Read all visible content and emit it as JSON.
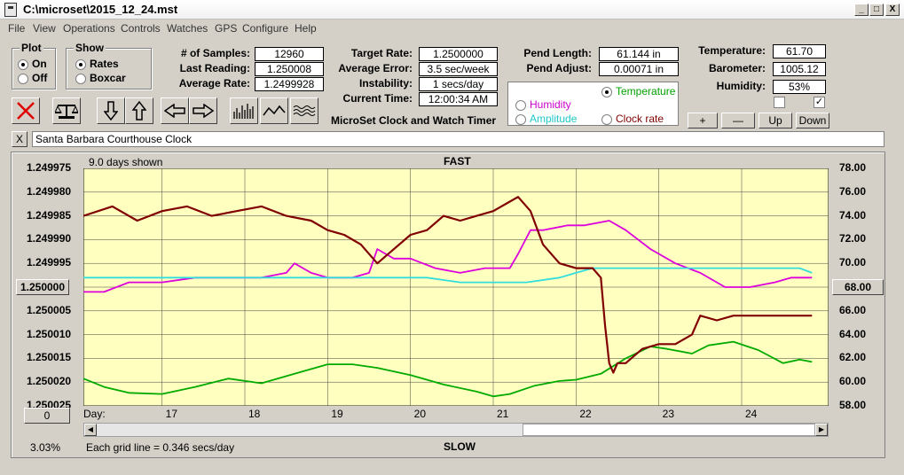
{
  "window": {
    "title": "C:\\microset\\2015_12_24.mst",
    "min_label": "_",
    "max_label": "□",
    "close_label": "X"
  },
  "menu": [
    "File",
    "View",
    "Operations",
    "Controls",
    "Watches",
    "GPS",
    "Configure",
    "Help"
  ],
  "plot_group": {
    "title": "Plot",
    "on_label": "On",
    "off_label": "Off",
    "selected": "On"
  },
  "show_group": {
    "title": "Show",
    "rates_label": "Rates",
    "boxcar_label": "Boxcar",
    "selected": "Rates"
  },
  "stats": {
    "samples_label": "# of Samples:",
    "samples": "12960",
    "last_reading_label": "Last Reading:",
    "last_reading": "1.250008",
    "average_rate_label": "Average Rate:",
    "average_rate": "1.2499928",
    "target_rate_label": "Target Rate:",
    "target_rate": "1.2500000",
    "average_error_label": "Average Error:",
    "average_error": "3.5 sec/week",
    "instability_label": "Instability:",
    "instability": "1 secs/day",
    "current_time_label": "Current Time:",
    "current_time": "12:00:34 AM",
    "pend_length_label": "Pend Length:",
    "pend_length": "61.144 in",
    "pend_adjust_label": "Pend Adjust:",
    "pend_adjust": "0.00071 in",
    "temperature_label": "Temperature:",
    "temperature": "61.70",
    "barometer_label": "Barometer:",
    "barometer": "1005.12",
    "humidity_label": "Humidity:",
    "humidity": "53%"
  },
  "app_caption": "MicroSet Clock and Watch Timer",
  "overlay": {
    "temperature": "Temperature",
    "humidity": "Humidity",
    "amplitude": "Amplitude",
    "clock_rate": "Clock rate",
    "selected": "Temperature"
  },
  "scale_buttons": {
    "plus": "+",
    "minus": "—",
    "up": "Up",
    "down": "Down"
  },
  "checkboxes": {
    "left": "",
    "right": "✓"
  },
  "clock_close": "X",
  "clock_name": "Santa Barbara Courthouse Clock",
  "graph": {
    "days_shown": "9.0 days shown",
    "top_label": "FAST",
    "bottom_label": "SLOW",
    "day_label": "Day:",
    "center_button": "1.250000",
    "right_center_button": "68.00",
    "zero_button": "0",
    "percent": "3.03%",
    "grid_note": "Each grid line = 0.346 secs/day"
  },
  "colors": {
    "plot_bg": "#ffffc0",
    "rate": "#800000",
    "temperature": "#00aa00",
    "humidity": "#dd00dd",
    "amplitude": "#33dddd"
  },
  "chart_data": {
    "type": "line",
    "title": "",
    "xlabel": "Day:",
    "x_ticks": [
      "17",
      "18",
      "19",
      "20",
      "21",
      "22",
      "23",
      "24"
    ],
    "x_tick_values": [
      17,
      18,
      19,
      20,
      21,
      22,
      23,
      24
    ],
    "xlim": [
      16.05,
      25.05
    ],
    "y_left_ticks": [
      "1.249975",
      "1.249980",
      "1.249985",
      "1.249990",
      "1.249995",
      "1.250000",
      "1.250005",
      "1.250010",
      "1.250015",
      "1.250020",
      "1.250025"
    ],
    "y_left_tick_values": [
      1.249975,
      1.24998,
      1.249985,
      1.24999,
      1.249995,
      1.25,
      1.250005,
      1.25001,
      1.250015,
      1.25002,
      1.250025
    ],
    "y_left_lim": [
      1.249975,
      1.250025
    ],
    "y_left_inverted": true,
    "y_right_ticks": [
      "78.00",
      "76.00",
      "74.00",
      "72.00",
      "70.00",
      "68.00",
      "66.00",
      "64.00",
      "62.00",
      "60.00",
      "58.00"
    ],
    "y_right_tick_values": [
      78,
      76,
      74,
      72,
      70,
      68,
      66,
      64,
      62,
      60,
      58
    ],
    "y_right_lim": [
      58,
      78
    ],
    "grid": true,
    "series": [
      {
        "key": "rate",
        "axis": "left",
        "x": [
          16.05,
          16.4,
          16.7,
          17.0,
          17.3,
          17.6,
          17.9,
          18.2,
          18.5,
          18.8,
          19.0,
          19.2,
          19.4,
          19.6,
          19.8,
          20.0,
          20.2,
          20.4,
          20.6,
          20.8,
          21.0,
          21.2,
          21.3,
          21.45,
          21.6,
          21.8,
          22.0,
          22.2,
          22.3,
          22.35,
          22.4,
          22.45,
          22.5,
          22.6,
          22.8,
          23.0,
          23.2,
          23.4,
          23.5,
          23.7,
          23.9,
          24.1,
          24.3,
          24.5,
          24.7,
          24.85
        ],
        "y": [
          1.249985,
          1.249983,
          1.249986,
          1.249984,
          1.249983,
          1.249985,
          1.249984,
          1.249983,
          1.249985,
          1.249986,
          1.249988,
          1.249989,
          1.249991,
          1.249995,
          1.249992,
          1.249989,
          1.249988,
          1.249985,
          1.249986,
          1.249985,
          1.249984,
          1.249982,
          1.249981,
          1.249984,
          1.249991,
          1.249995,
          1.249996,
          1.249996,
          1.249998,
          1.250008,
          1.250016,
          1.250018,
          1.250016,
          1.250016,
          1.250013,
          1.250012,
          1.250012,
          1.25001,
          1.250006,
          1.250007,
          1.250006,
          1.250006,
          1.250006,
          1.250006,
          1.250006,
          1.250006
        ]
      },
      {
        "key": "temperature",
        "axis": "right",
        "x": [
          16.05,
          16.3,
          16.6,
          17.0,
          17.4,
          17.8,
          18.2,
          18.6,
          19.0,
          19.3,
          19.6,
          20.0,
          20.4,
          20.8,
          21.0,
          21.2,
          21.5,
          21.8,
          22.0,
          22.3,
          22.6,
          22.9,
          23.1,
          23.4,
          23.6,
          23.9,
          24.2,
          24.5,
          24.7,
          24.85
        ],
        "y": [
          60.3,
          59.6,
          59.1,
          59.0,
          59.6,
          60.3,
          59.9,
          60.7,
          61.5,
          61.5,
          61.2,
          60.6,
          59.8,
          59.2,
          58.8,
          59.0,
          59.7,
          60.1,
          60.2,
          60.7,
          62.0,
          63.0,
          62.8,
          62.4,
          63.1,
          63.4,
          62.7,
          61.6,
          61.9,
          61.7
        ]
      },
      {
        "key": "humidity",
        "axis": "left",
        "x": [
          16.05,
          16.3,
          16.6,
          17.0,
          17.4,
          17.8,
          18.2,
          18.5,
          18.6,
          18.8,
          19.0,
          19.3,
          19.5,
          19.6,
          19.8,
          20.0,
          20.3,
          20.6,
          20.9,
          21.2,
          21.3,
          21.45,
          21.6,
          21.9,
          22.1,
          22.4,
          22.6,
          22.9,
          23.2,
          23.5,
          23.8,
          24.1,
          24.4,
          24.6,
          24.7,
          24.85
        ],
        "y": [
          1.250001,
          1.250001,
          1.249999,
          1.249999,
          1.249998,
          1.249998,
          1.249998,
          1.249997,
          1.249995,
          1.249997,
          1.249998,
          1.249998,
          1.249997,
          1.249992,
          1.249994,
          1.249994,
          1.249996,
          1.249997,
          1.249996,
          1.249996,
          1.249993,
          1.249988,
          1.249988,
          1.249987,
          1.249987,
          1.249986,
          1.249988,
          1.249992,
          1.249995,
          1.249997,
          1.25,
          1.25,
          1.249999,
          1.249998,
          1.249998,
          1.249998
        ]
      },
      {
        "key": "amplitude",
        "axis": "left",
        "x": [
          16.05,
          16.3,
          16.6,
          17.0,
          17.4,
          17.8,
          18.2,
          18.6,
          19.0,
          19.4,
          19.8,
          20.2,
          20.6,
          21.0,
          21.4,
          21.8,
          22.0,
          22.2,
          22.4,
          22.8,
          23.2,
          23.6,
          24.0,
          24.4,
          24.6,
          24.7,
          24.85
        ],
        "y": [
          1.249998,
          1.249998,
          1.249998,
          1.249998,
          1.249998,
          1.249998,
          1.249998,
          1.249998,
          1.249998,
          1.249998,
          1.249998,
          1.249998,
          1.249999,
          1.249999,
          1.249999,
          1.249998,
          1.249997,
          1.249996,
          1.249996,
          1.249996,
          1.249996,
          1.249996,
          1.249996,
          1.249996,
          1.249996,
          1.249996,
          1.249997
        ]
      }
    ]
  }
}
